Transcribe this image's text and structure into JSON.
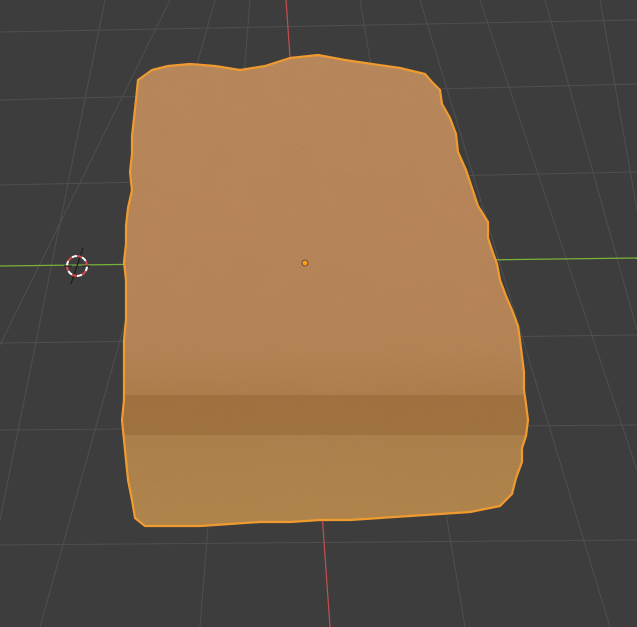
{
  "viewport": {
    "background_color": "#3d3d3d",
    "grid_color": "#4f4f4f",
    "axis_x_color": "#c44f4f",
    "axis_y_color": "#7ab23c",
    "selection_outline_color": "#f09b2f",
    "origin_dot_color": "#ff9c1a",
    "cursor_color_primary": "#d94848",
    "cursor_color_secondary": "#ffffff"
  },
  "object": {
    "top_color": "#c98a66",
    "top_color_light": "#d9a184",
    "side_color": "#a07018",
    "side_color_dark": "#6f5010",
    "transition_color": "#8f5c2d"
  },
  "icons": {
    "cursor": "3d-cursor-icon",
    "origin": "object-origin-icon"
  }
}
